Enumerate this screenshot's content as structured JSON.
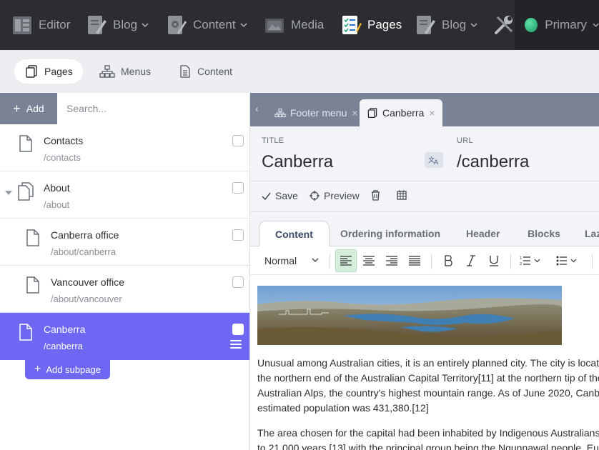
{
  "topbar": {
    "items": [
      {
        "label": "Editor",
        "icon": "editor-icon",
        "chevron": false
      },
      {
        "label": "Blog",
        "icon": "blog-edit-icon",
        "chevron": true
      },
      {
        "label": "Content",
        "icon": "content-gear-icon",
        "chevron": true
      },
      {
        "label": "Media",
        "icon": "media-icon",
        "chevron": false
      },
      {
        "label": "Pages",
        "icon": "pages-checklist-icon",
        "chevron": false,
        "active": true
      },
      {
        "label": "Blog",
        "icon": "blog-edit-icon",
        "chevron": true
      }
    ],
    "tools_icon": "tools-icon",
    "site_selector": {
      "label": "Primary",
      "color": "#2ec486"
    }
  },
  "subtabs": [
    {
      "label": "Pages",
      "icon": "pages-icon",
      "active": true
    },
    {
      "label": "Menus",
      "icon": "menus-tree-icon",
      "active": false
    },
    {
      "label": "Content",
      "icon": "content-doc-icon",
      "active": false
    }
  ],
  "left": {
    "add_label": "Add",
    "search_placeholder": "Search...",
    "pages": [
      {
        "name": "Contacts",
        "path": "/contacts",
        "level": 0
      },
      {
        "name": "About",
        "path": "/about",
        "level": 0,
        "expanded": true
      },
      {
        "name": "Canberra office",
        "path": "/about/canberra",
        "level": 1
      },
      {
        "name": "Vancouver office",
        "path": "/about/vancouver",
        "level": 1
      },
      {
        "name": "Canberra",
        "path": "/canberra",
        "level": 0,
        "selected": true
      }
    ],
    "add_subpage_label": "Add subpage"
  },
  "right": {
    "tabs": [
      {
        "label": "Footer menu",
        "icon": "menus-tree-icon"
      },
      {
        "label": "Canberra",
        "icon": "pages-icon",
        "active": true
      }
    ],
    "title_label": "TITLE",
    "title_value": "Canberra",
    "url_label": "URL",
    "url_value": "/canberra",
    "actions": {
      "save": "Save",
      "preview": "Preview"
    },
    "content_tabs": [
      "Content",
      "Ordering information",
      "Header",
      "Blocks",
      "Laz"
    ],
    "format_value": "Normal",
    "paragraphs": [
      [
        "Unusual among Australian cities, it is an entirely planned city. The city is locat",
        "the northern end of the Australian Capital Territory[11] at the northern tip of the",
        "Australian Alps, the country's highest mountain range. As of June 2020, Canb",
        "estimated population was 431,380.[12]"
      ],
      [
        "The area chosen for the capital had been inhabited by Indigenous Australians",
        "to 21,000 years.[13] with the principal group being the Ngunnawal people. Eu"
      ]
    ]
  },
  "colors": {
    "accent": "#6d67f4",
    "topbar": "#2b2d31",
    "tab_bar": "#7a8296"
  }
}
